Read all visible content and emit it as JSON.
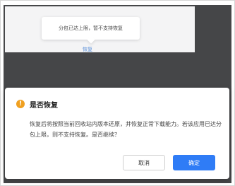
{
  "tooltip": {
    "text": "分包已达上限，暂不支持恢复"
  },
  "link": {
    "label": "恢复"
  },
  "dialog": {
    "title": "是否恢复",
    "icon": "warning-icon",
    "icon_glyph": "!",
    "body": "恢复后将按照当前回收站内版本还原，并恢复正常下载能力。若该应用已达分包上限，则不支持恢复。是否继续？",
    "cancel_label": "取消",
    "confirm_label": "确定"
  },
  "colors": {
    "overlay": "#454648",
    "accent": "#2f7cf6",
    "warning": "#f0a020",
    "link": "#5a8fd8"
  }
}
